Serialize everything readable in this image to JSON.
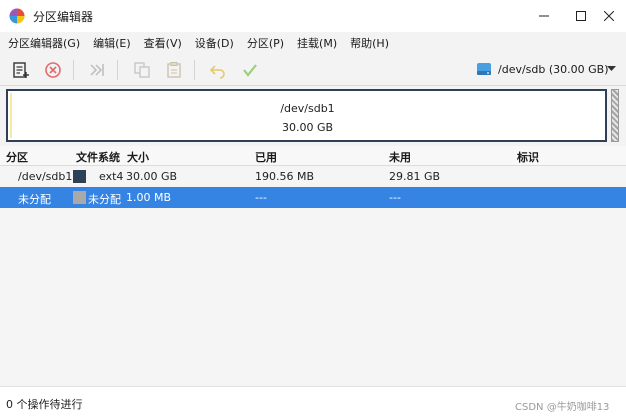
{
  "window": {
    "title": "分区编辑器"
  },
  "menubar": {
    "items": [
      "分区编辑器(G)",
      "编辑(E)",
      "查看(V)",
      "设备(D)",
      "分区(P)",
      "挂载(M)",
      "帮助(H)"
    ]
  },
  "toolbar": {
    "buttons": [
      "new-partition-icon",
      "delete-icon",
      "resize-move-icon",
      "copy-icon",
      "paste-icon",
      "undo-icon",
      "apply-icon"
    ],
    "device": "/dev/sdb (30.00 GB)"
  },
  "diskmap": {
    "name": "/dev/sdb1",
    "size": "30.00 GB"
  },
  "table": {
    "headers": [
      "分区",
      "文件系统",
      "大小",
      "已用",
      "未用",
      "标识"
    ],
    "rows": [
      {
        "partition": "/dev/sdb1",
        "fs_color": "#2f3f55",
        "filesystem": "ext4",
        "size": "30.00 GB",
        "used": "190.56 MB",
        "unused": "29.81 GB",
        "flags": ""
      },
      {
        "partition": "未分配",
        "fs_color": "#a9a9a9",
        "filesystem": "未分配",
        "size": "1.00 MB",
        "used": "---",
        "unused": "---",
        "flags": "",
        "selected": true
      }
    ]
  },
  "status": {
    "text": "0 个操作待进行"
  },
  "watermark": "CSDN @牛奶咖啡13",
  "colors": {
    "selection": "#3584e4",
    "partition_border": "#2f3f55",
    "unallocated": "#a9a9a9"
  }
}
